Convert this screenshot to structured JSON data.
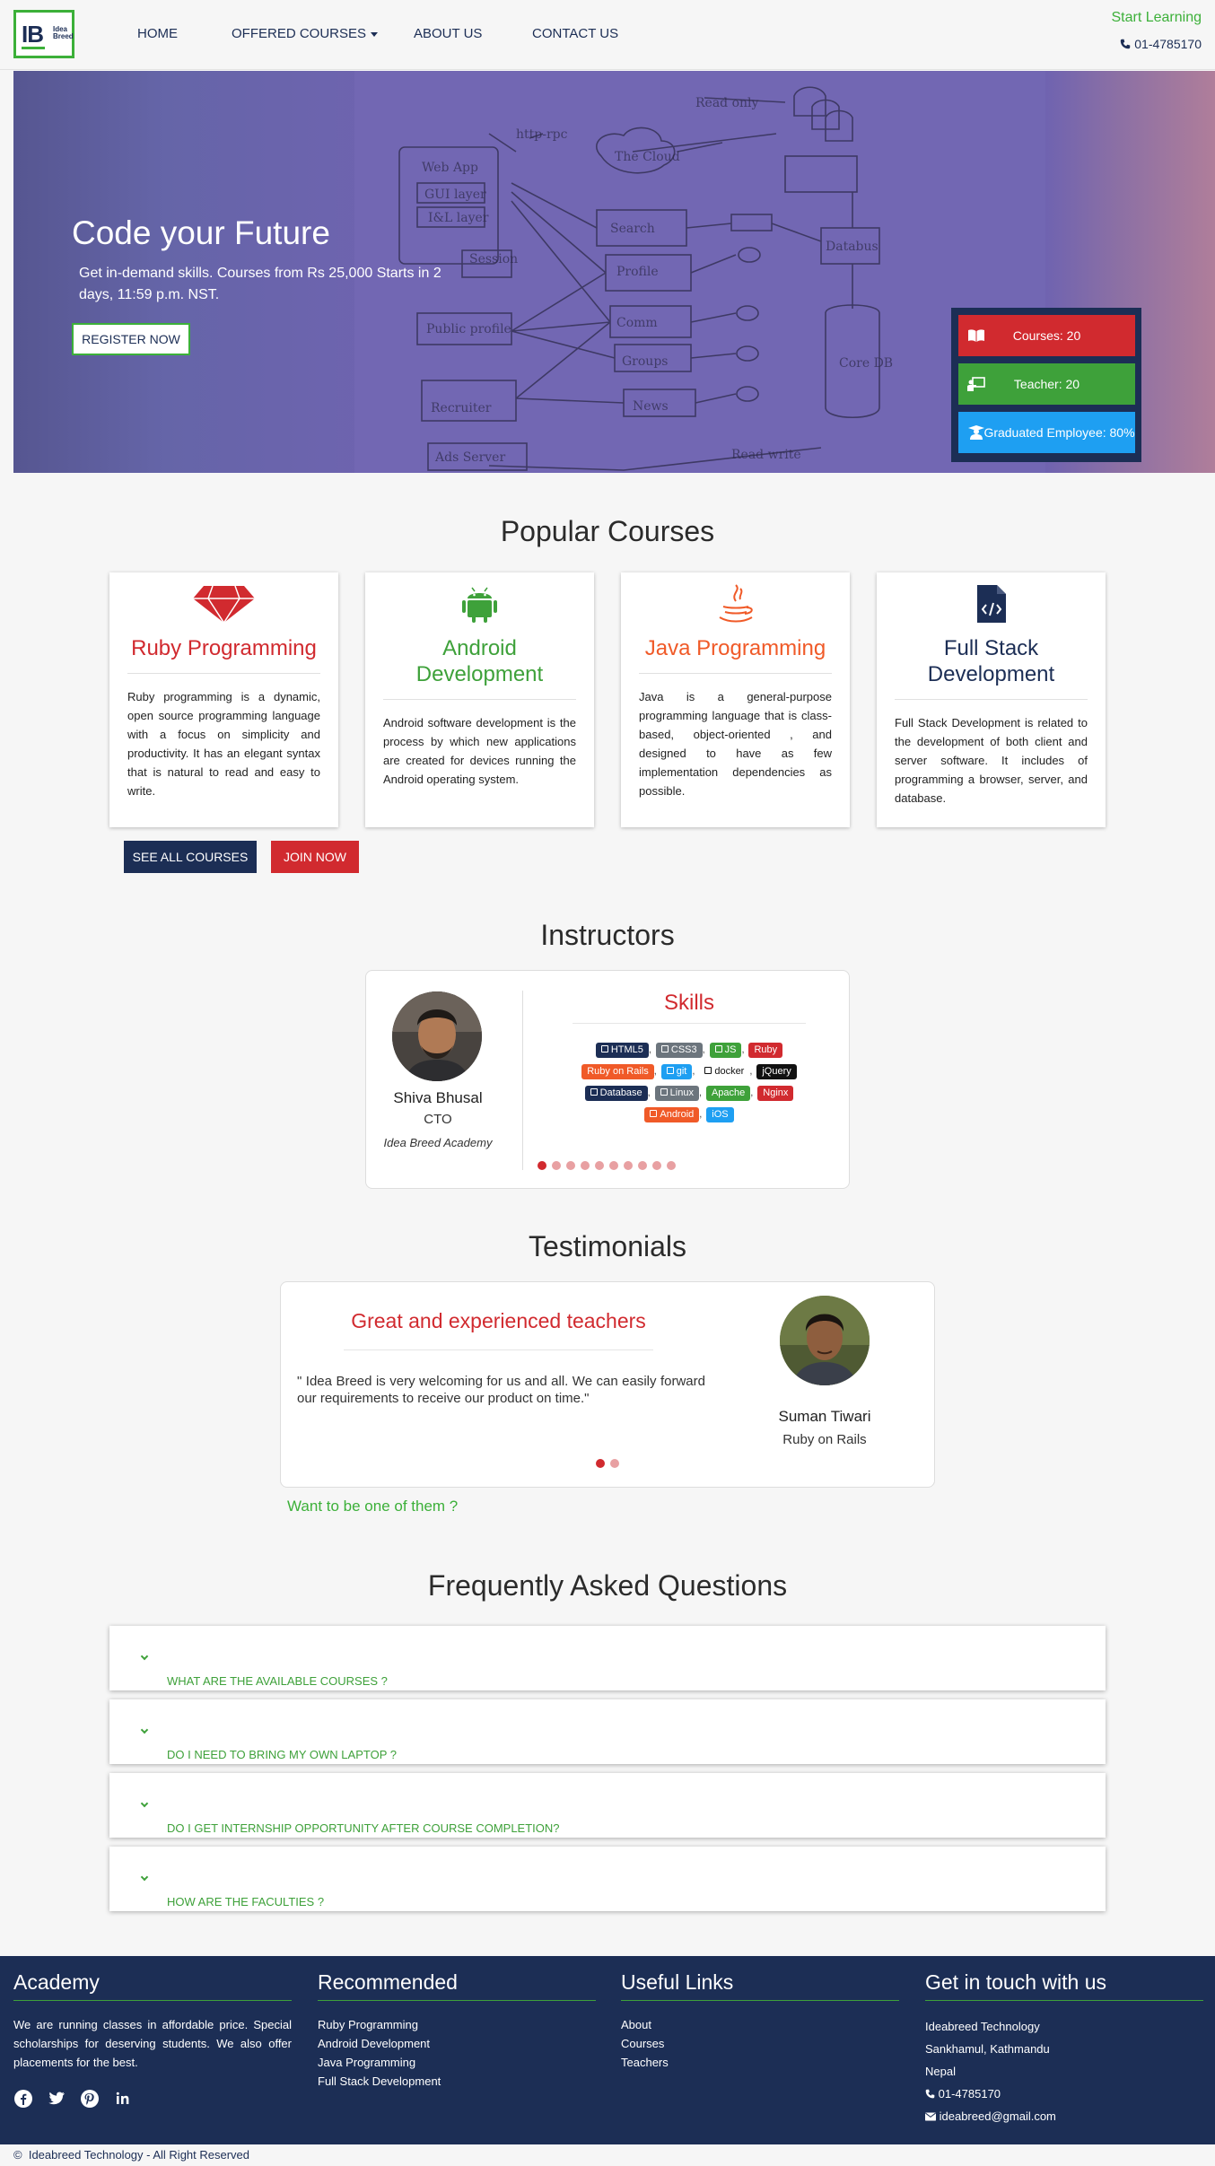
{
  "nav": {
    "logo": {
      "mark": "IB",
      "line1": "Idea",
      "line2": "Breed"
    },
    "links": [
      "HOME",
      "OFFERED COURSES",
      "ABOUT US",
      "CONTACT US"
    ],
    "start_learning": "Start Learning",
    "phone": "01-4785170"
  },
  "hero": {
    "title": "Code your Future",
    "subtitle": "Get in-demand skills. Courses from Rs 25,000 Starts in 2 days, 11:59 p.m. NST.",
    "register_button": "REGISTER NOW",
    "stats": {
      "courses": "Courses: 20",
      "teacher": "Teacher: 20",
      "graduated": "Graduated Employee: 80%"
    }
  },
  "popular_courses": {
    "title": "Popular Courses",
    "cards": [
      {
        "icon": "gem-icon",
        "title": "Ruby Programming",
        "color": "#d12a2f",
        "description": "Ruby programming is a dynamic, open source programming language with a focus on simplicity and productivity. It has an elegant syntax that is natural to read and easy to write."
      },
      {
        "icon": "android-icon",
        "title": "Android Development",
        "color": "#3ea13a",
        "description": "Android software development is the process by which new applications are created for devices running the Android operating system."
      },
      {
        "icon": "java-icon",
        "title": "Java Programming",
        "color": "#f05a28",
        "description": "Java is a general-purpose programming language that is class-based, object-oriented , and designed to have as few implementation dependencies as possible."
      },
      {
        "icon": "code-file-icon",
        "title": "Full Stack Development",
        "color": "#1c2e55",
        "description": "Full Stack Development is related to the development of both client and server software. It includes of programming a browser, server, and database."
      }
    ],
    "see_all": "SEE ALL COURSES",
    "join": "JOIN NOW"
  },
  "instructors": {
    "title": "Instructors",
    "name": "Shiva Bhusal",
    "role": "CTO",
    "org": "Idea Breed Academy",
    "skills_title": "Skills",
    "skills": [
      [
        {
          "label": "HTML5",
          "color": "#1c2e55",
          "icon": "html5-icon"
        },
        {
          "label": "CSS3",
          "color": "#6c757d",
          "icon": "css3-icon"
        },
        {
          "label": "JS",
          "color": "#3ea13a",
          "icon": "js-icon"
        },
        {
          "label": "Ruby",
          "color": "#d12a2f",
          "icon": ""
        }
      ],
      [
        {
          "label": "Ruby on Rails",
          "color": "#f05a28",
          "icon": ""
        },
        {
          "label": "git",
          "color": "#1e9ff2",
          "icon": "git-icon"
        },
        {
          "label": "docker",
          "color": "#ffffff",
          "icon": "docker-icon"
        },
        {
          "label": "jQuery",
          "color": "#111111",
          "icon": ""
        }
      ],
      [
        {
          "label": "Database",
          "color": "#1c2e55",
          "icon": "database-icon"
        },
        {
          "label": "Linux",
          "color": "#6c757d",
          "icon": "linux-icon"
        },
        {
          "label": "Apache",
          "color": "#3ea13a",
          "icon": ""
        },
        {
          "label": "Nginx",
          "color": "#d12a2f",
          "icon": ""
        }
      ],
      [
        {
          "label": "Android",
          "color": "#f05a28",
          "icon": "android-icon"
        },
        {
          "label": "iOS",
          "color": "#1e9ff2",
          "icon": ""
        }
      ]
    ],
    "slides": 10,
    "active_slide": 0
  },
  "testimonials": {
    "title": "Testimonials",
    "heading": "Great and experienced teachers",
    "quote": "\" Idea Breed is very welcoming for us and all. We can easily forward our requirements to receive our product on time.\"",
    "name": "Suman Tiwari",
    "course": "Ruby on Rails",
    "slides": 2,
    "active_slide": 0,
    "want": "Want to be one of them ?"
  },
  "faq": {
    "title": "Frequently Asked Questions",
    "items": [
      "WHAT ARE THE AVAILABLE COURSES ?",
      "DO I NEED TO BRING MY OWN LAPTOP ?",
      "DO I GET INTERNSHIP OPPORTUNITY AFTER COURSE COMPLETION?",
      "HOW ARE THE FACULTIES ?"
    ]
  },
  "footer": {
    "academy": {
      "title": "Academy",
      "text": "We are running classes in affordable price. Special scholarships for deserving students. We also offer placements for the best."
    },
    "recommended": {
      "title": "Recommended",
      "links": [
        "Ruby Programming",
        "Android Development",
        "Java Programming",
        "Full Stack Development"
      ]
    },
    "useful": {
      "title": "Useful Links",
      "links": [
        "About",
        "Courses",
        "Teachers"
      ]
    },
    "contact": {
      "title": "Get in touch with us",
      "company": "Ideabreed Technology",
      "address1": "Sankhamul, Kathmandu",
      "address2": "Nepal",
      "phone": "01-4785170",
      "email": "ideabreed@gmail.com"
    },
    "social": [
      "facebook-icon",
      "twitter-icon",
      "pinterest-icon",
      "linkedin-icon"
    ],
    "copyright": "Ideabreed Technology - All Right Reserved",
    "copyright_symbol": "©"
  },
  "colors": {
    "navy": "#1c2e55",
    "red": "#d12a2f",
    "green": "#3ea13a",
    "blue": "#1e9ff2",
    "orange": "#f05a28"
  }
}
